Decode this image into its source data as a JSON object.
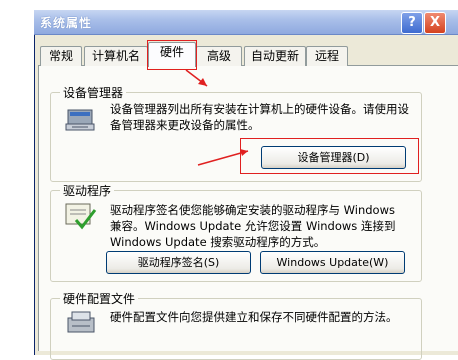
{
  "window": {
    "title": "系统属性",
    "help_label": "?",
    "close_label": "X"
  },
  "tabs": [
    {
      "label": "常规"
    },
    {
      "label": "计算机名"
    },
    {
      "label": "硬件"
    },
    {
      "label": "高级"
    },
    {
      "label": "自动更新"
    },
    {
      "label": "远程"
    }
  ],
  "groups": {
    "device_manager": {
      "label": "设备管理器",
      "desc": "设备管理器列出所有安装在计算机上的硬件设备。请使用设备管理器来更改设备的属性。",
      "button": "设备管理器(D)"
    },
    "drivers": {
      "label": "驱动程序",
      "desc": "驱动程序签名使您能够确定安装的驱动程序与 Windows 兼容。Windows Update 允许您设置 Windows 连接到 Windows Update 搜索驱动程序的方式。",
      "button_signing": "驱动程序签名(S)",
      "button_update": "Windows Update(W)"
    },
    "hw_profiles": {
      "label": "硬件配置文件",
      "desc": "硬件配置文件向您提供建立和保存不同硬件配置的方法。"
    }
  },
  "colors": {
    "annotation": "#E02020",
    "titlebar": "#8FA9DF",
    "dialog_bg": "#ECE9D8"
  }
}
